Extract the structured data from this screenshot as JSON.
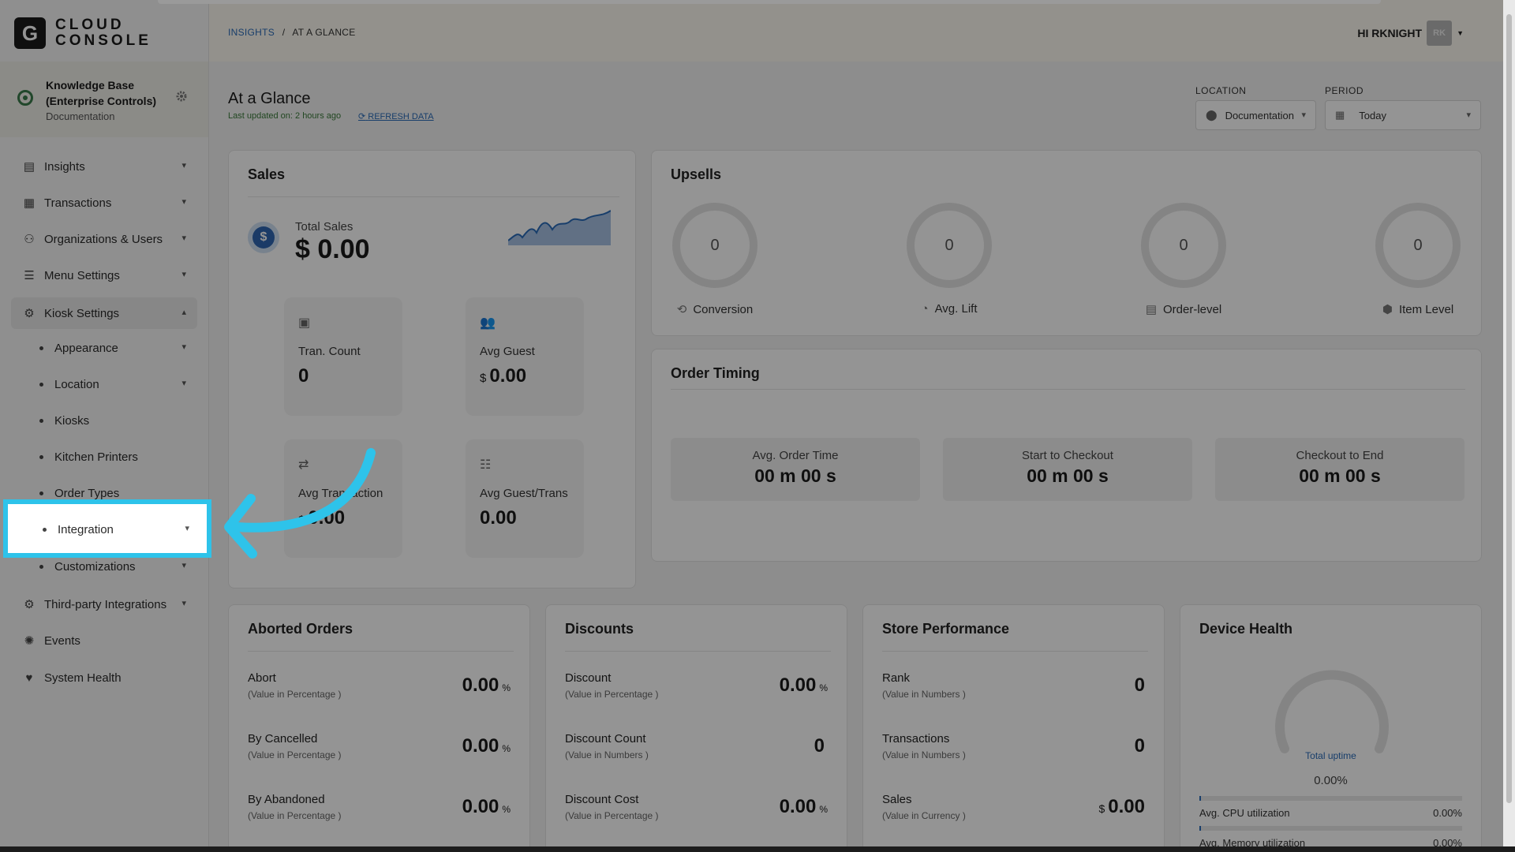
{
  "app": {
    "logo_letter": "G",
    "logo_line1": "CLOUD",
    "logo_line2": "CONSOLE"
  },
  "workspace": {
    "title": "Knowledge Base (Enterprise Controls)",
    "subtitle": "Documentation"
  },
  "breadcrumb": {
    "root": "INSIGHTS",
    "separator": "/",
    "current": "AT A GLANCE"
  },
  "user": {
    "greeting": "HI RKNIGHT",
    "initials": "RK"
  },
  "sidebar": {
    "items": [
      {
        "label": "Insights"
      },
      {
        "label": "Transactions"
      },
      {
        "label": "Organizations & Users"
      },
      {
        "label": "Menu Settings"
      },
      {
        "label": "Kiosk Settings"
      },
      {
        "label": "Appearance"
      },
      {
        "label": "Location"
      },
      {
        "label": "Kiosks"
      },
      {
        "label": "Kitchen Printers"
      },
      {
        "label": "Order Types"
      },
      {
        "label": "Integration"
      },
      {
        "label": "Customizations"
      },
      {
        "label": "Third-party Integrations"
      },
      {
        "label": "Events"
      },
      {
        "label": "System Health"
      }
    ]
  },
  "page": {
    "title": "At a Glance",
    "updated": "Last updated on: 2 hours ago",
    "refresh": "REFRESH DATA"
  },
  "filters": {
    "location_label": "LOCATION",
    "location_value": "Documentation",
    "period_label": "PERIOD",
    "period_value": "Today"
  },
  "sales": {
    "title": "Sales",
    "total_label": "Total Sales",
    "total_value": "$ 0.00",
    "tiles": [
      {
        "label": "Tran. Count",
        "prefix": "",
        "value": "0"
      },
      {
        "label": "Avg Guest",
        "prefix": "$",
        "value": "0.00"
      },
      {
        "label": "Avg Transaction",
        "prefix": "$",
        "value": "0.00"
      },
      {
        "label": "Avg Guest/Trans",
        "prefix": "",
        "value": "0.00"
      }
    ]
  },
  "upsells": {
    "title": "Upsells",
    "items": [
      {
        "label": "Conversion",
        "value": "0"
      },
      {
        "label": "Avg. Lift",
        "value": "0"
      },
      {
        "label": "Order-level",
        "value": "0"
      },
      {
        "label": "Item Level",
        "value": "0"
      }
    ]
  },
  "order_timing": {
    "title": "Order Timing",
    "items": [
      {
        "label": "Avg. Order Time",
        "value": "00 m 00 s"
      },
      {
        "label": "Start to Checkout",
        "value": "00 m 00 s"
      },
      {
        "label": "Checkout to End",
        "value": "00 m 00 s"
      }
    ]
  },
  "aborted": {
    "title": "Aborted Orders",
    "rows": [
      {
        "name": "Abort",
        "sub": "(Value in Percentage )",
        "value": "0.00",
        "unit": "%"
      },
      {
        "name": "By Cancelled",
        "sub": "(Value in Percentage )",
        "value": "0.00",
        "unit": "%"
      },
      {
        "name": "By Abandoned",
        "sub": "(Value in Percentage )",
        "value": "0.00",
        "unit": "%"
      }
    ]
  },
  "discounts": {
    "title": "Discounts",
    "rows": [
      {
        "name": "Discount",
        "sub": "(Value in Percentage )",
        "value": "0.00",
        "unit": "%"
      },
      {
        "name": "Discount Count",
        "sub": "(Value in Numbers )",
        "value": "0",
        "unit": ""
      },
      {
        "name": "Discount Cost",
        "sub": "(Value in Percentage )",
        "value": "0.00",
        "unit": "%"
      }
    ]
  },
  "store": {
    "title": "Store Performance",
    "rows": [
      {
        "name": "Rank",
        "sub": "(Value in Numbers )",
        "value": "0",
        "prefix": ""
      },
      {
        "name": "Transactions",
        "sub": "(Value in Numbers )",
        "value": "0",
        "prefix": ""
      },
      {
        "name": "Sales",
        "sub": "(Value in Currency )",
        "value": "0.00",
        "prefix": "$"
      }
    ]
  },
  "device": {
    "title": "Device Health",
    "uptime_label": "Total uptime",
    "uptime_value": "0.00%",
    "bars": [
      {
        "label": "Avg. CPU utilization",
        "value": "0.00%"
      },
      {
        "label": "Avg. Memory utilization",
        "value": "0.00%"
      }
    ]
  },
  "colors": {
    "accent": "#2a6bb8",
    "highlight": "#2ec3ea",
    "success": "#3a7a3a"
  }
}
